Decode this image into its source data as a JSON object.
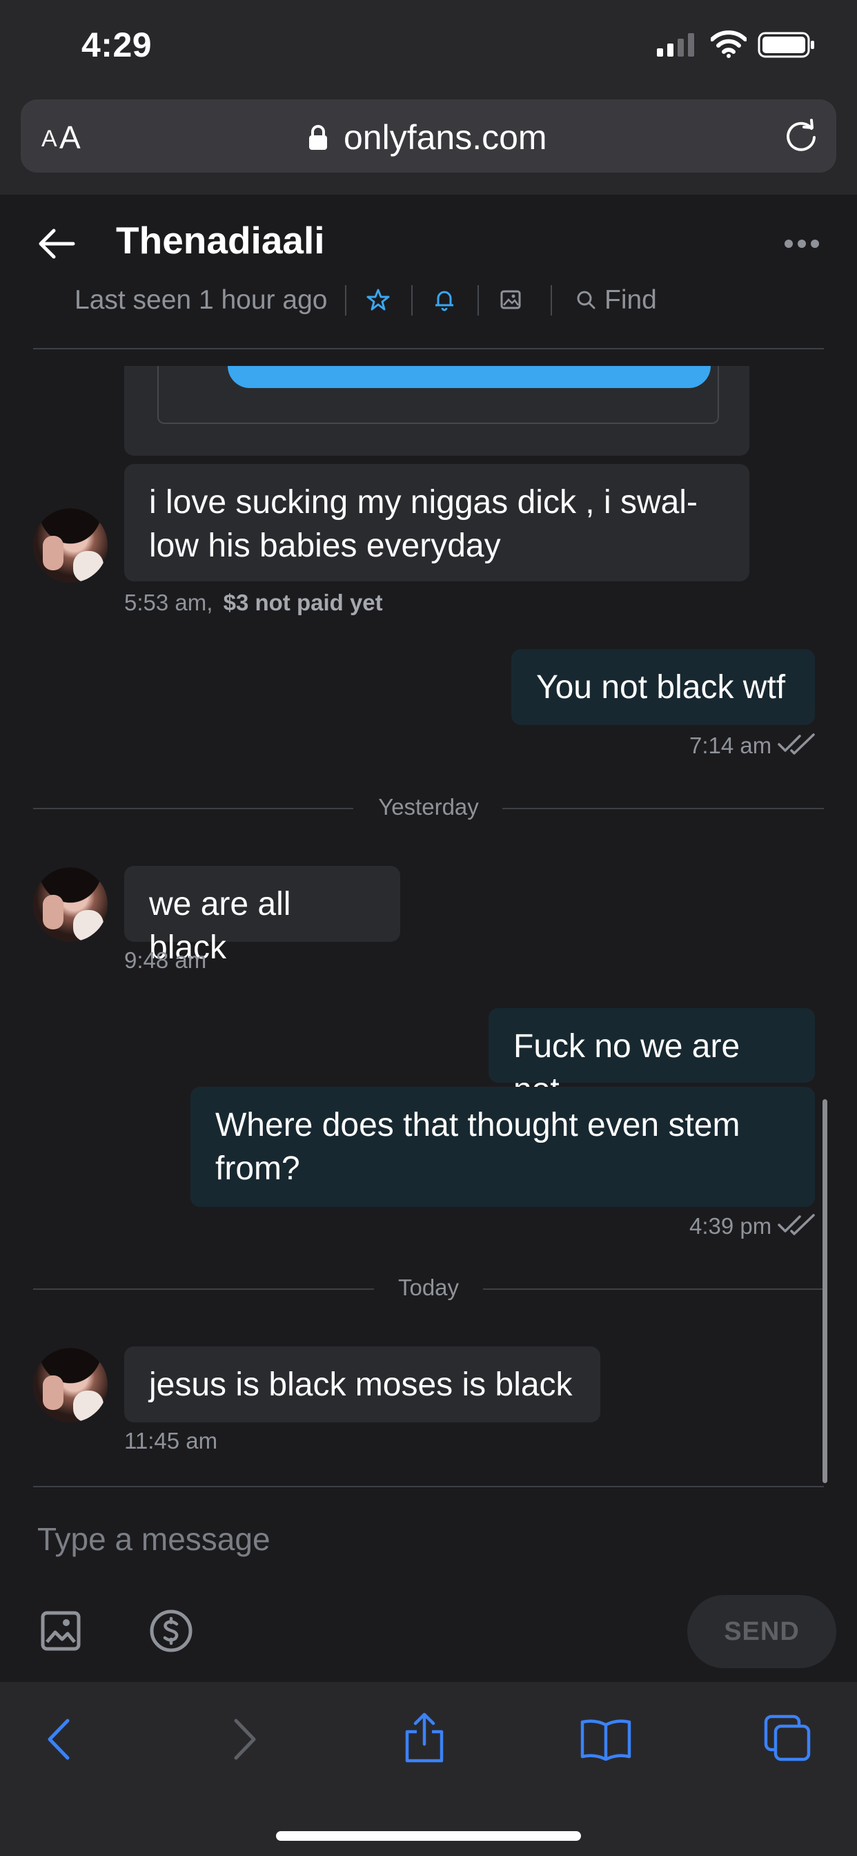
{
  "status": {
    "time": "4:29"
  },
  "browser": {
    "text_size_small": "A",
    "text_size_large": "A",
    "url": "onlyfans.com"
  },
  "chat": {
    "contact_name": "Thenadiaali",
    "last_seen": "Last seen 1 hour ago",
    "find_label": "Find",
    "messages": [
      {
        "direction": "in",
        "text": "i love sucking my niggas dick , i swal-",
        "text2": "low his babies everyday",
        "time": "5:53 am,",
        "price_note": "$3 not paid yet"
      },
      {
        "direction": "out",
        "text": "You not black wtf",
        "time": "7:14 am"
      },
      {
        "direction": "in",
        "text": "we are all black",
        "time": "9:48 am"
      },
      {
        "direction": "out",
        "text": "Fuck no we are not"
      },
      {
        "direction": "out",
        "text": "Where does that thought even stem",
        "text2": "from?",
        "time": "4:39 pm"
      },
      {
        "direction": "in",
        "text": "jesus is black moses is black",
        "time": "11:45 am"
      }
    ],
    "day_dividers": [
      "Yesterday",
      "Today"
    ]
  },
  "composer": {
    "placeholder": "Type a message",
    "send_label": "SEND"
  },
  "colors": {
    "background": "#1b1b1e",
    "chrome": "#28282b",
    "accent": "#3aa7f0",
    "incoming_bubble": "#2a2b2f",
    "outgoing_bubble": "#182830",
    "muted_text": "#8f9399",
    "safari_blue": "#3b82f6"
  }
}
